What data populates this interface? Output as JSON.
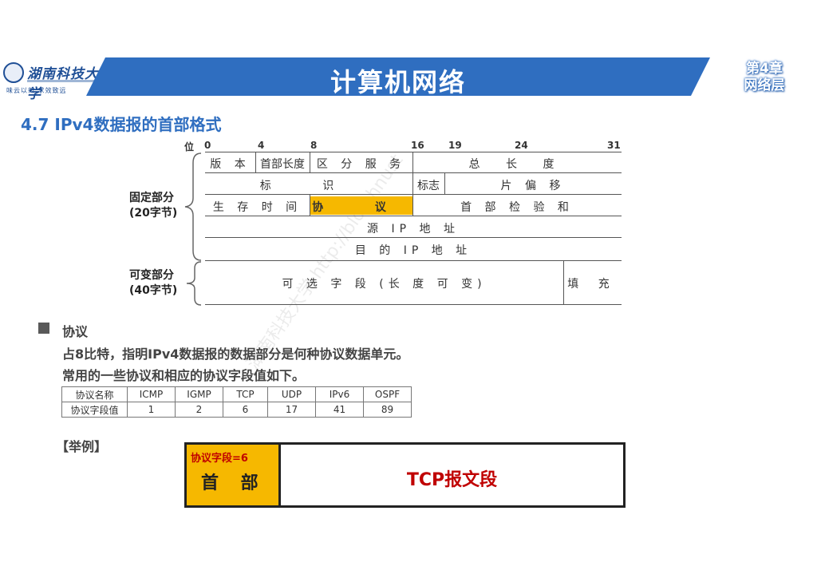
{
  "header": {
    "logo_name": "湖南科技大学",
    "logo_motto": "味云以新   求效致远",
    "title": "计算机网络",
    "chapter": "第4章",
    "chapter_sub": "网络层"
  },
  "section_title": "4.7 IPv4数据报的首部格式",
  "diagram": {
    "bit_label": "位",
    "bits": [
      "0",
      "4",
      "8",
      "16",
      "19",
      "24",
      "31"
    ],
    "fixed_label": "固定部分",
    "fixed_size": "(20字节)",
    "variable_label": "可变部分",
    "variable_size": "(40字节)",
    "fields": {
      "version": "版 本",
      "header_length": "首部长度",
      "dsfield": "区 分 服 务",
      "total_length": "总 长 度",
      "identification": "标 识",
      "flags": "标志",
      "fragment_offset": "片 偏 移",
      "ttl": "生 存 时 间",
      "protocol": "协 议",
      "checksum": "首 部 检 验 和",
      "src": "源 IP 地 址",
      "dst": "目 的 IP 地 址",
      "options": "可 选 字 段 (长 度 可 变)",
      "padding": "填 充"
    },
    "highlight_color": "#F6B800"
  },
  "notes": {
    "heading": "协议",
    "line1": "占8比特，指明IPv4数据报的数据部分是何种协议数据单元。",
    "line2": "常用的一些协议和相应的协议字段值如下。"
  },
  "protocol_table": {
    "row_headers": [
      "协议名称",
      "协议字段值"
    ],
    "names": [
      "ICMP",
      "IGMP",
      "TCP",
      "UDP",
      "IPv6",
      "OSPF"
    ],
    "values": [
      "1",
      "2",
      "6",
      "17",
      "41",
      "89"
    ]
  },
  "example": {
    "label": "【举例】",
    "field": "协议字段=6",
    "header_text": "首 部",
    "segment_text": "TCP报文段"
  },
  "watermark": "湖南科技大学 http://blog.hnust"
}
